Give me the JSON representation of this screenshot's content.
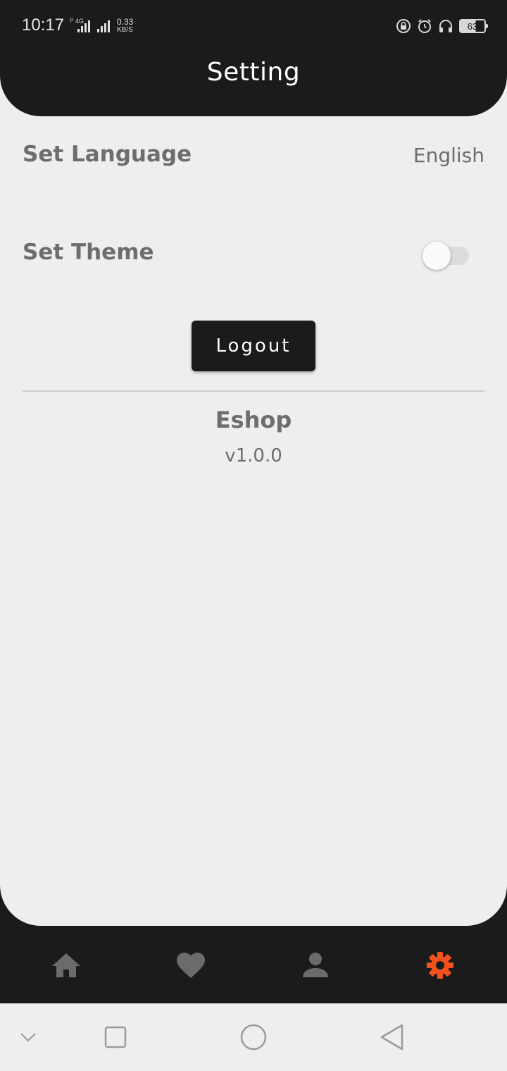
{
  "status_bar": {
    "time": "10:17",
    "network_tag": "P",
    "network_type": "4G",
    "speed_value": "0.33",
    "speed_unit": "KB/S",
    "battery": "63"
  },
  "header": {
    "title": "Setting"
  },
  "settings": {
    "language_label": "Set Language",
    "language_value": "English",
    "theme_label": "Set Theme",
    "theme_dark_enabled": false,
    "logout_label": "Logout"
  },
  "about": {
    "app_name": "Eshop",
    "version": "v1.0.0"
  },
  "bottom_nav": {
    "items": [
      {
        "icon": "home-icon",
        "active": false
      },
      {
        "icon": "heart-icon",
        "active": false
      },
      {
        "icon": "person-icon",
        "active": false
      },
      {
        "icon": "gear-icon",
        "active": true
      }
    ],
    "inactive_color": "#6b6b6b",
    "active_color": "#f4511e"
  },
  "colors": {
    "dark": "#1b1b1b",
    "background": "#eeeeee",
    "text_muted": "#6d6d6d",
    "accent": "#f4511e"
  }
}
